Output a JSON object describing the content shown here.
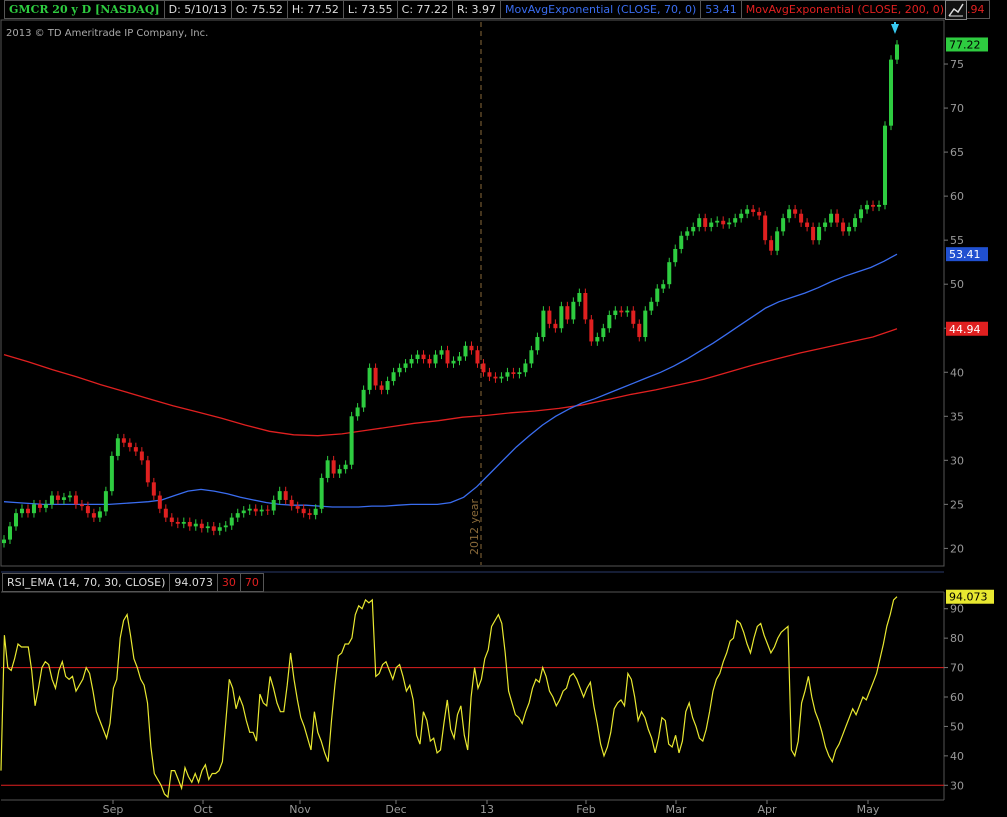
{
  "header": {
    "symbol": "GMCR 20 y D [NASDAQ]",
    "date": "D: 5/10/13",
    "open": "O: 75.52",
    "high": "H: 77.52",
    "low": "L: 73.55",
    "close": "C: 77.22",
    "range": "R: 3.97",
    "ema70_label": "MovAvgExponential (CLOSE, 70, 0)",
    "ema70_value": "53.41",
    "ema200_label": "MovAvgExponential (CLOSE, 200, 0)",
    "ema200_value": "44.94"
  },
  "copyright": "2013 © TD Ameritrade IP Company, Inc.",
  "year_marker": "2012 year",
  "indicator": {
    "label": "RSI_EMA (14, 70, 30, CLOSE)",
    "value": "94.073",
    "oversold": "30",
    "overbought": "70"
  },
  "colors": {
    "up": "#2ecc40",
    "down": "#e02020",
    "ema70": "#3a6df0",
    "ema200": "#e02020",
    "rsi": "#e8e830",
    "accent": "#38c8f0"
  },
  "chart_data": [
    {
      "type": "candlestick",
      "ylim": [
        18,
        80
      ],
      "yticks": [
        20,
        25,
        30,
        35,
        40,
        45,
        50,
        55,
        60,
        65,
        70,
        75
      ],
      "xticks": [
        "Sep",
        "Oct",
        "Nov",
        "Dec",
        "13",
        "Feb",
        "Mar",
        "Apr",
        "May"
      ],
      "last_price": "77.22",
      "closes": [
        21,
        22.5,
        24,
        24.5,
        24,
        25,
        24.6,
        25,
        26,
        25.5,
        25.8,
        26,
        25,
        24.8,
        24,
        23.5,
        24.2,
        26.5,
        30.5,
        32.5,
        32,
        31.5,
        31,
        30,
        27.5,
        26,
        24.5,
        23.5,
        23,
        22.8,
        23,
        22.5,
        22.8,
        22.3,
        22.5,
        22,
        22.4,
        22.6,
        23.5,
        24,
        24.3,
        24.5,
        24.2,
        24.4,
        24.3,
        25.5,
        26.5,
        25.5,
        24.8,
        24.5,
        24,
        23.8,
        24.5,
        28,
        30,
        28.5,
        29,
        29.5,
        35,
        36,
        38,
        40.5,
        38.5,
        38,
        39,
        40,
        40.5,
        41,
        41.5,
        42,
        41.5,
        41,
        42,
        42.5,
        41,
        41.3,
        41.8,
        43,
        42.5,
        41,
        40,
        39.5,
        39.3,
        39.5,
        40,
        39.8,
        40,
        41,
        42.5,
        44,
        47,
        45.5,
        45,
        47.5,
        46,
        48,
        49,
        46,
        43.5,
        44,
        45,
        46.5,
        47,
        46.8,
        47,
        45.5,
        44,
        47,
        48,
        49.5,
        50,
        52.5,
        54,
        55.5,
        56,
        56.5,
        57.5,
        56.5,
        57,
        57.2,
        56.8,
        57,
        57.5,
        58,
        58.5,
        58.2,
        57.8,
        55,
        53.8,
        56,
        57.5,
        58.5,
        58,
        57,
        56.5,
        55,
        56.5,
        57,
        58,
        57,
        56,
        56.5,
        57.5,
        58.5,
        59,
        58.8,
        59,
        68,
        75.5,
        77.22
      ],
      "ema70": [
        25.3,
        25.2,
        25.1,
        25,
        25,
        25,
        25,
        25,
        25,
        25.1,
        25.2,
        25.3,
        25.5,
        26,
        26.5,
        26.7,
        26.5,
        26.2,
        25.8,
        25.5,
        25.2,
        25,
        24.9,
        24.9,
        24.8,
        24.7,
        24.7,
        24.7,
        24.8,
        24.8,
        24.9,
        25,
        25,
        25,
        25.2,
        25.8,
        27,
        28.5,
        30,
        31.5,
        32.8,
        34,
        35,
        35.8,
        36.5,
        37,
        37.6,
        38.2,
        38.8,
        39.4,
        40,
        40.7,
        41.5,
        42.4,
        43.3,
        44.3,
        45.3,
        46.3,
        47.3,
        48,
        48.5,
        49,
        49.6,
        50.3,
        50.9,
        51.4,
        51.9,
        52.6,
        53.41
      ],
      "ema200": [
        42,
        41.2,
        40.3,
        39.5,
        38.6,
        37.8,
        37,
        36.2,
        35.5,
        34.8,
        34,
        33.3,
        32.9,
        32.8,
        33,
        33.4,
        33.8,
        34.2,
        34.5,
        34.9,
        35.1,
        35.4,
        35.6,
        35.9,
        36.3,
        36.9,
        37.5,
        38,
        38.6,
        39.2,
        40,
        40.8,
        41.5,
        42.2,
        42.8,
        43.4,
        44,
        44.94
      ]
    },
    {
      "type": "line",
      "title": "RSI_EMA (14, 70, 30, CLOSE)",
      "ylim": [
        25,
        95
      ],
      "yticks": [
        30,
        40,
        50,
        60,
        70,
        80,
        90
      ],
      "levels": [
        30,
        70
      ],
      "values": [
        35,
        81,
        70,
        69,
        73,
        78,
        77,
        77,
        77,
        69,
        57,
        63,
        70,
        72,
        71,
        66,
        63,
        69,
        72,
        67,
        66,
        67,
        62,
        64,
        66,
        70,
        68,
        62,
        55,
        52,
        49,
        46,
        51,
        63,
        66,
        80,
        86,
        88,
        81,
        73,
        70,
        66,
        64,
        58,
        43,
        34,
        32,
        30,
        27,
        26,
        35,
        35,
        32,
        29,
        36,
        33,
        31,
        34,
        31,
        35,
        37,
        32,
        34,
        34,
        35,
        38,
        52,
        66,
        63,
        56,
        60,
        57,
        52,
        48,
        48,
        45,
        61,
        58,
        57,
        67,
        63,
        58,
        55,
        55,
        64,
        75,
        66,
        59,
        53,
        50,
        46,
        42,
        55,
        48,
        45,
        41,
        38,
        52,
        64,
        74,
        75,
        78,
        78,
        80,
        88,
        91,
        90,
        93,
        92,
        93,
        67,
        68,
        71,
        72,
        69,
        66,
        70,
        71,
        67,
        62,
        64,
        59,
        47,
        44,
        55,
        52,
        45,
        46,
        41,
        42,
        51,
        59,
        49,
        46,
        54,
        57,
        47,
        42,
        60,
        70,
        63,
        66,
        73,
        76,
        84,
        86,
        88,
        85,
        75,
        62,
        58,
        54,
        53,
        51,
        55,
        58,
        63,
        66,
        65,
        70,
        67,
        62,
        60,
        57,
        59,
        62,
        63,
        67,
        68,
        66,
        63,
        60,
        63,
        65,
        57,
        51,
        44,
        40,
        43,
        48,
        56,
        58,
        59,
        57,
        68,
        66,
        60,
        52,
        55,
        53,
        49,
        46,
        41,
        46,
        53,
        52,
        44,
        43,
        47,
        41,
        45,
        55,
        58,
        53,
        50,
        46,
        45,
        49,
        55,
        62,
        66,
        68,
        72,
        75,
        79,
        80,
        86,
        85,
        82,
        78,
        75,
        80,
        84,
        85,
        81,
        78,
        75,
        77,
        80,
        82,
        83,
        84,
        42,
        40,
        45,
        58,
        62,
        67,
        60,
        55,
        52,
        48,
        43,
        40,
        38,
        42,
        44,
        47,
        50,
        53,
        56,
        54,
        57,
        60,
        59,
        62,
        65,
        68,
        73,
        78,
        84,
        88,
        93,
        94.073
      ]
    }
  ]
}
